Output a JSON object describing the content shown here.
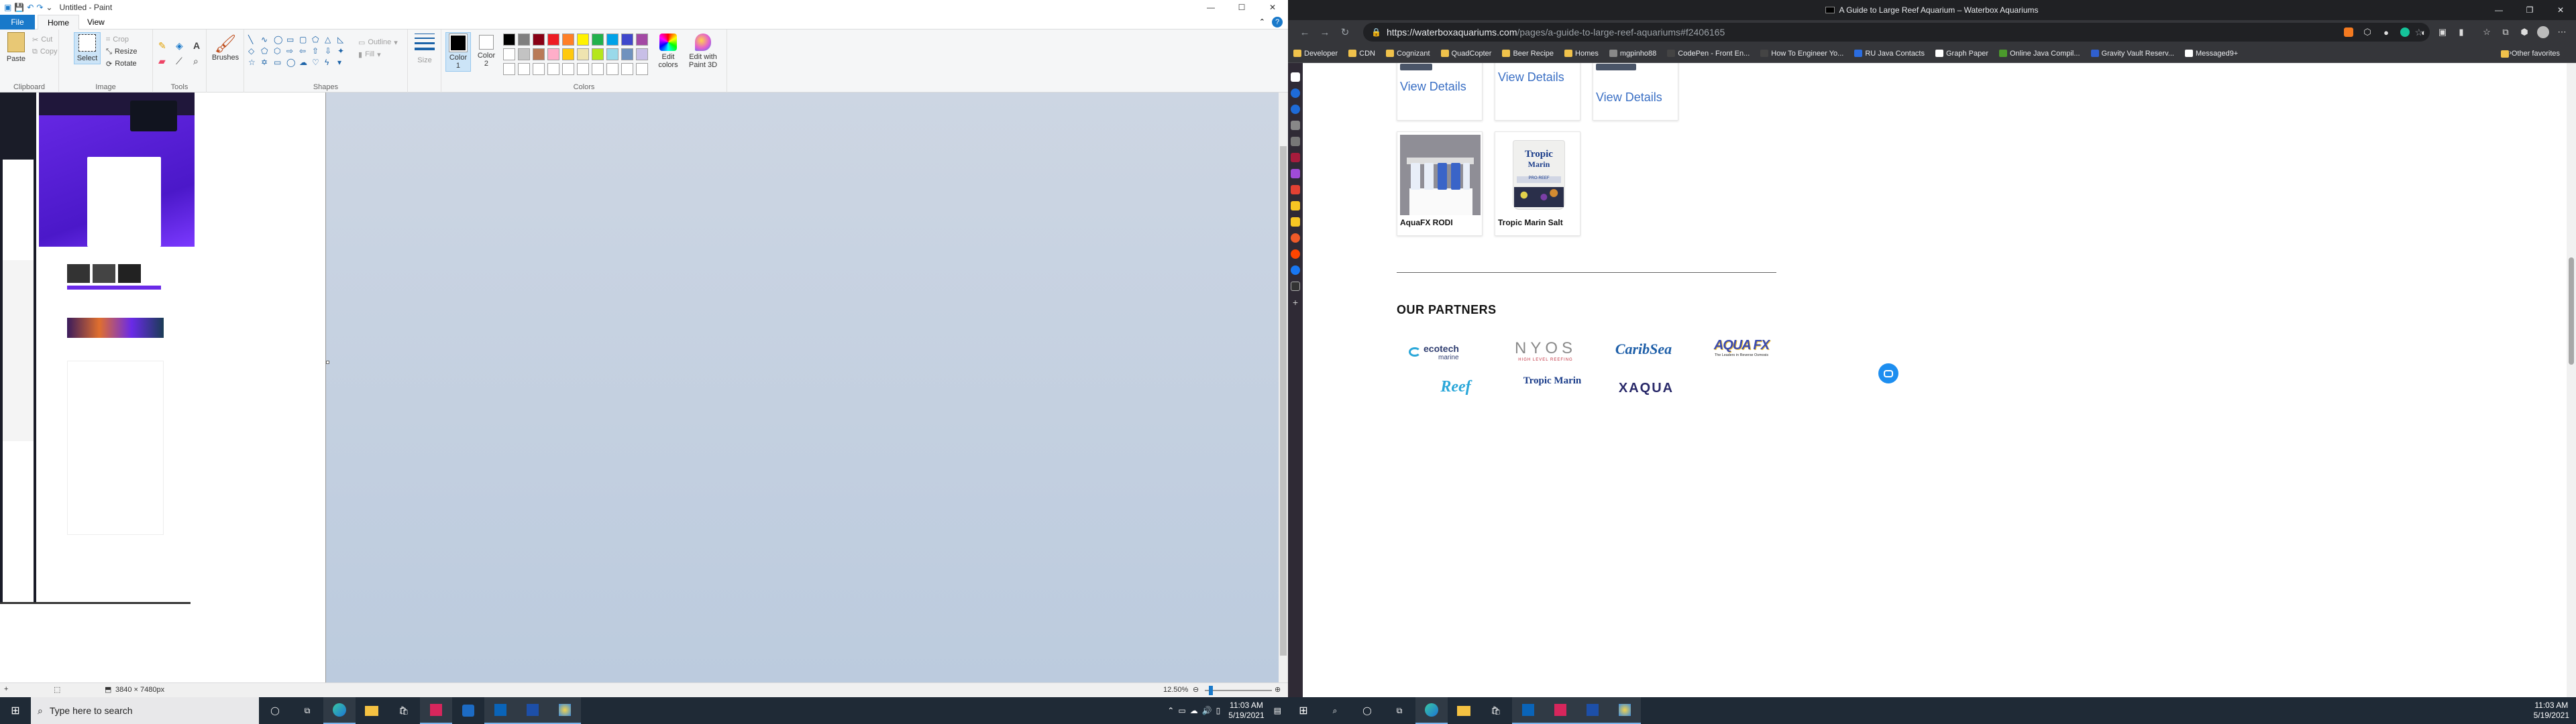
{
  "paint": {
    "title": "Untitled - Paint",
    "tabs": [
      "File",
      "Home",
      "View"
    ],
    "clipboard": {
      "paste": "Paste",
      "cut": "Cut",
      "copy": "Copy",
      "group": "Clipboard"
    },
    "image": {
      "select": "Select",
      "crop": "Crop",
      "resize": "Resize",
      "rotate": "Rotate",
      "group": "Image"
    },
    "tools": {
      "group": "Tools"
    },
    "brushes": "Brushes",
    "shapes": {
      "outline": "Outline",
      "fill": "Fill",
      "group": "Shapes"
    },
    "size": "Size",
    "color1": "Color\n1",
    "color2": "Color\n2",
    "edit_colors": "Edit\ncolors",
    "edit_paint3d": "Edit with\nPaint 3D",
    "colors_group": "Colors",
    "palette_colors": [
      "#000000",
      "#7f7f7f",
      "#880015",
      "#ed1c24",
      "#ff7f27",
      "#fff200",
      "#22b14c",
      "#00a2e8",
      "#3f48cc",
      "#a349a4",
      "#ffffff",
      "#c3c3c3",
      "#b97a57",
      "#ffaec9",
      "#ffc90e",
      "#efe4b0",
      "#b5e61d",
      "#99d9ea",
      "#7092be",
      "#c8bfe7"
    ],
    "status_dims": "3840 × 7480px",
    "zoom": "12.50%"
  },
  "taskbar": {
    "search_placeholder": "Type here to search",
    "time": "11:03 AM",
    "date": "5/19/2021"
  },
  "browser": {
    "title": "A Guide to Large Reef Aquarium – Waterbox Aquariums",
    "url_host": "https://waterboxaquariums.com",
    "url_path": "/pages/a-guide-to-large-reef-aquariums#f2406165",
    "bookmarks": [
      "Developer",
      "CDN",
      "Cognizant",
      "QuadCopter",
      "Beer Recipe",
      "Homes",
      "mgpinho88",
      "CodePen - Front En...",
      "How To Engineer Yo...",
      "RU Java Contacts",
      "Graph Paper",
      "Online Java Compil...",
      "Gravity Vault Reserv...",
      "Messaged9+"
    ],
    "other_favorites": "Other favorites",
    "view_details": "View Details",
    "products": [
      {
        "name": "AquaFX RODI"
      },
      {
        "name": "Tropic Marin Salt"
      }
    ],
    "salt_label": {
      "brand": "Tropic",
      "brand2": "Marin",
      "line": "PRO-REEF"
    },
    "partners_heading": "OUR PARTNERS",
    "partners": [
      {
        "name": "ecotech",
        "sub": "marine"
      },
      {
        "name": "NYOS",
        "sub": "HIGH LEVEL REEFING"
      },
      {
        "name": "CaribSea",
        "sub": ""
      },
      {
        "name": "AQUA FX",
        "sub": "The Leaders in Reverse Osmosis"
      }
    ],
    "partners_row2": [
      "Reef",
      "Tropic Marin",
      "XAQUA"
    ]
  }
}
